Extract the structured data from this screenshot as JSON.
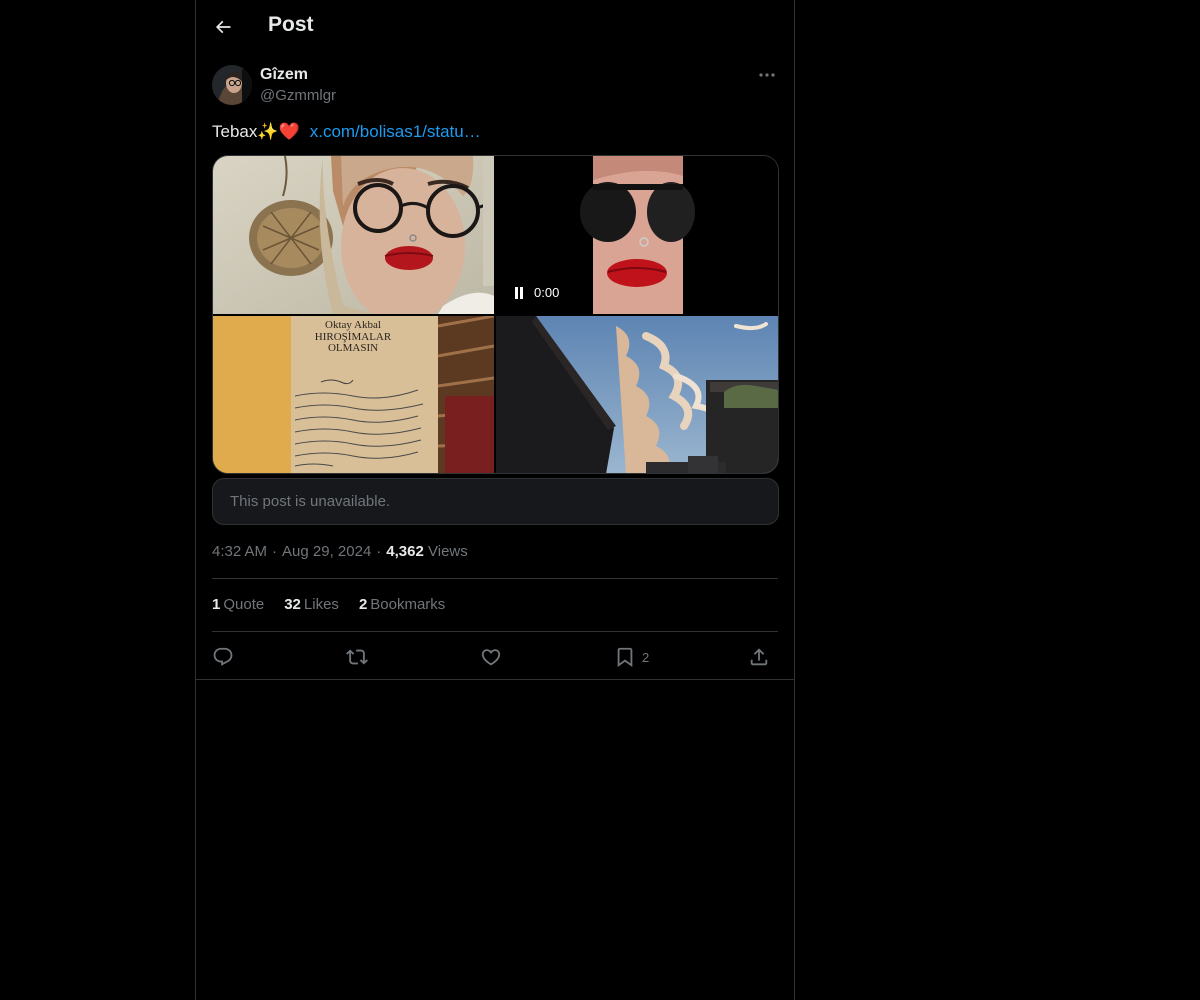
{
  "header": {
    "title": "Post",
    "back_icon": "arrow-left-icon"
  },
  "author": {
    "name": "Gîzem",
    "handle": "@Gzmmlgr"
  },
  "post": {
    "text": "Tebax",
    "emojis": "✨❤️",
    "link": "x.com/bolisas1/statu…"
  },
  "media": {
    "video_time": "0:00",
    "book_title_line1": "Oktay Akbal",
    "book_title_line2": "HIROŞİMALAR",
    "book_title_line3": "OLMASIN"
  },
  "quoted": {
    "unavailable_text": "This post is unavailable."
  },
  "meta": {
    "time": "4:32 AM",
    "date": "Aug 29, 2024",
    "views_count": "4,362",
    "views_label": "Views",
    "separator": "·"
  },
  "stats": {
    "quotes_count": "1",
    "quotes_label": "Quote",
    "likes_count": "32",
    "likes_label": "Likes",
    "bookmarks_count": "2",
    "bookmarks_label": "Bookmarks"
  },
  "actions": {
    "bookmark_count": "2"
  },
  "colors": {
    "background": "#000000",
    "border": "#2f3336",
    "text_primary": "#e7e9ea",
    "text_secondary": "#71767b",
    "link": "#1d9bf0"
  }
}
